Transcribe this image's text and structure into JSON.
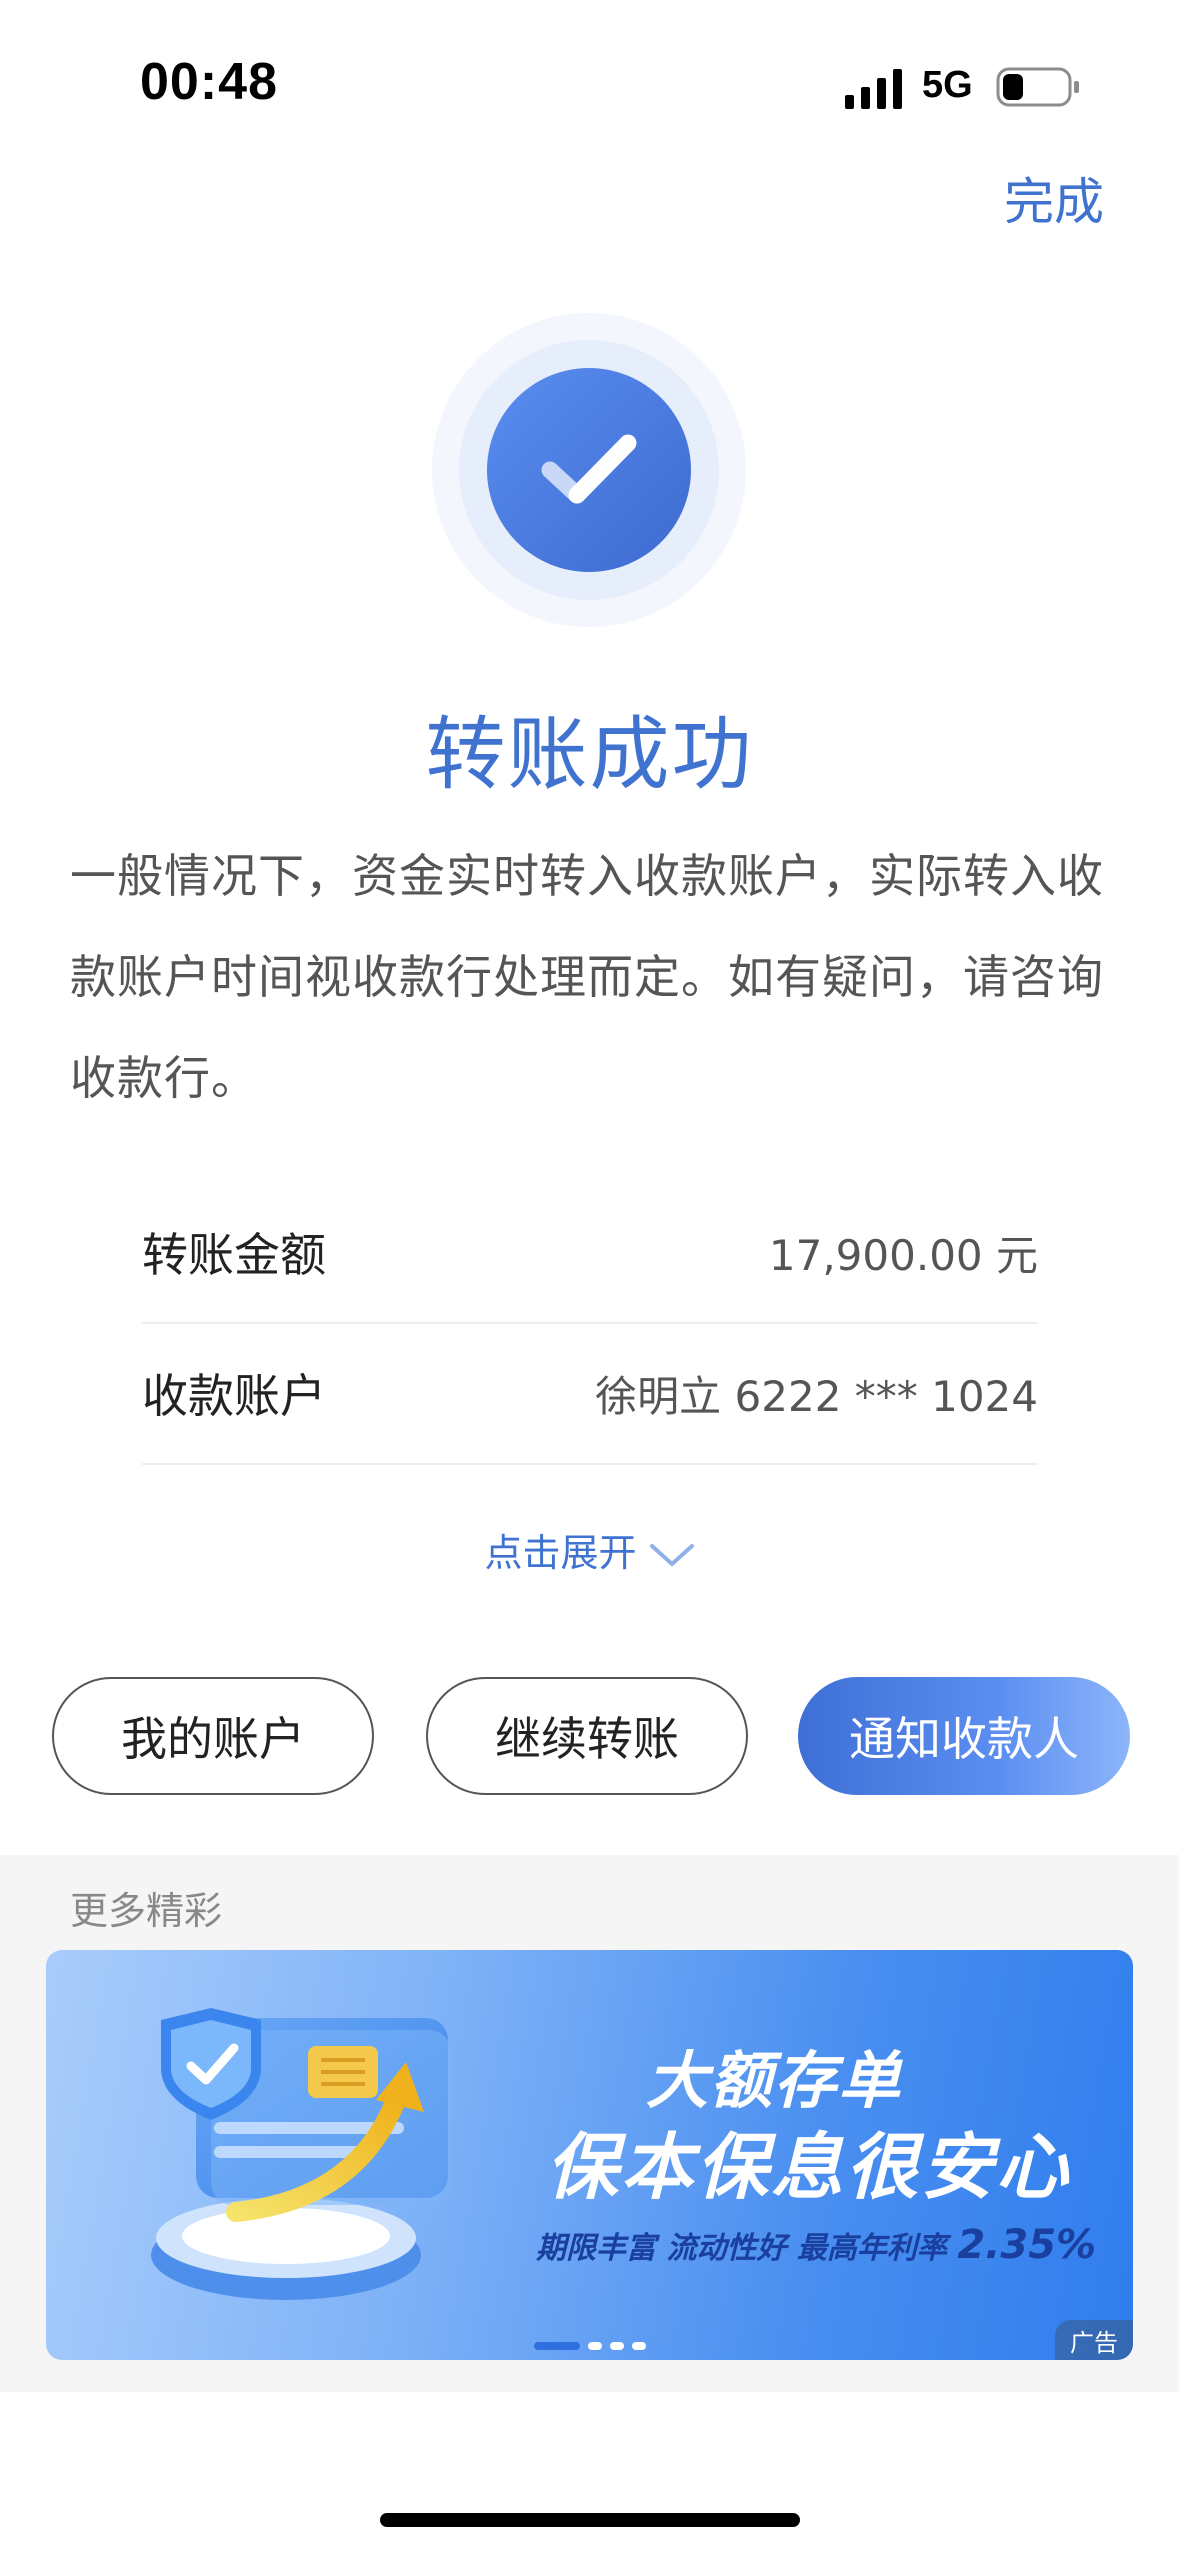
{
  "status_bar": {
    "time": "00:48",
    "network": "5G"
  },
  "header": {
    "done_label": "完成"
  },
  "result": {
    "title": "转账成功",
    "notice": "一般情况下，资金实时转入收款账户，实际转入收款账户时间视收款行处理而定。如有疑问，请咨询收款行。"
  },
  "details": [
    {
      "label": "转账金额",
      "value": "17,900.00 元"
    },
    {
      "label": "收款账户",
      "value": "徐明立 6222 *** 1024"
    }
  ],
  "expand_label": "点击展开",
  "actions": {
    "my_account": "我的账户",
    "continue_transfer": "继续转账",
    "notify_payee": "通知收款人"
  },
  "more": {
    "title": "更多精彩",
    "banner": {
      "headline": "大额存单",
      "subhead": "保本保息很安心",
      "features": "期限丰富 流动性好 最高年利率",
      "rate": "2.35%",
      "ad_tag": "广告",
      "slide_count": 4,
      "active_slide": 1
    }
  },
  "colors": {
    "accent": "#3f73cf",
    "section_bg": "#f5f5f6"
  }
}
